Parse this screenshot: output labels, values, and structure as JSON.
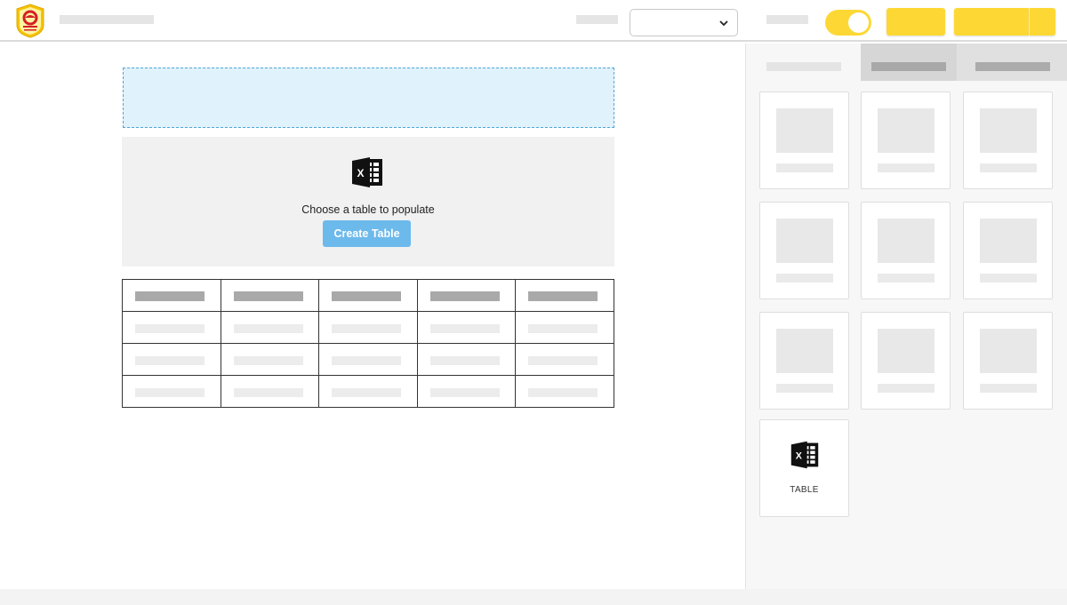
{
  "header": {
    "brand_colors": {
      "accent": "#fdd835",
      "logo_ring": "#f4c400",
      "logo_mark": "#d32027"
    },
    "logo_icon": "brand-badge-icon",
    "dropdown_icon": "chevron-down-icon",
    "toggle_state": "on"
  },
  "editor": {
    "populate_panel": {
      "icon": "excel-icon",
      "message": "Choose a table to populate",
      "create_button_label": "Create Table"
    },
    "table": {
      "columns": 5,
      "rows": 4
    }
  },
  "sidebar": {
    "tabs": [
      {
        "state": "active"
      },
      {
        "state": "inactive"
      },
      {
        "state": "inactive"
      }
    ],
    "table_widget": {
      "icon": "excel-icon",
      "label": "TABLE"
    }
  }
}
